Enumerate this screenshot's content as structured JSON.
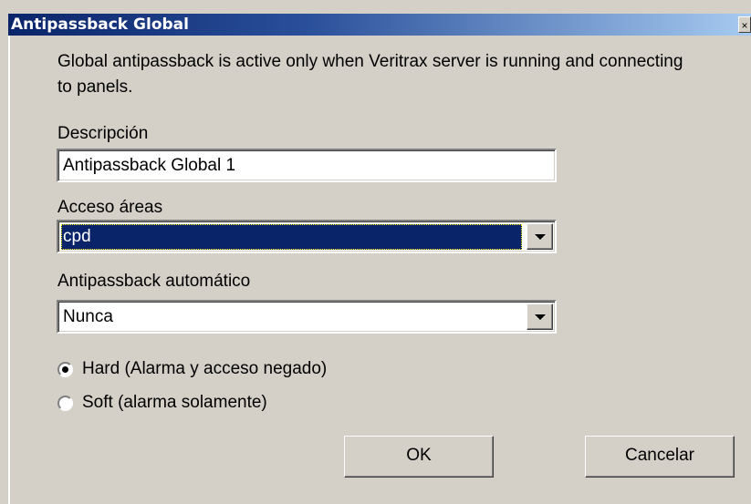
{
  "window": {
    "title": "Antipassback Global",
    "close_glyph": "×"
  },
  "info_text": "Global antipassback is active only when Veritrax server is running and connecting to panels.",
  "description": {
    "label": "Descripción",
    "value": "Antipassback Global 1"
  },
  "access_areas": {
    "label": "Acceso áreas",
    "selected": "cpd"
  },
  "auto_antipassback": {
    "label": "Antipassback automático",
    "selected": "Nunca"
  },
  "mode_options": [
    {
      "label": "Hard (Alarma y acceso negado)",
      "checked": true
    },
    {
      "label": "Soft (alarma solamente)",
      "checked": false
    }
  ],
  "buttons": {
    "ok": "OK",
    "cancel": "Cancelar"
  },
  "colors": {
    "titlebar_start": "#0a246a",
    "titlebar_end": "#a6caf0",
    "dialog_bg": "#d4d0c8",
    "selection_bg": "#0a246a"
  }
}
